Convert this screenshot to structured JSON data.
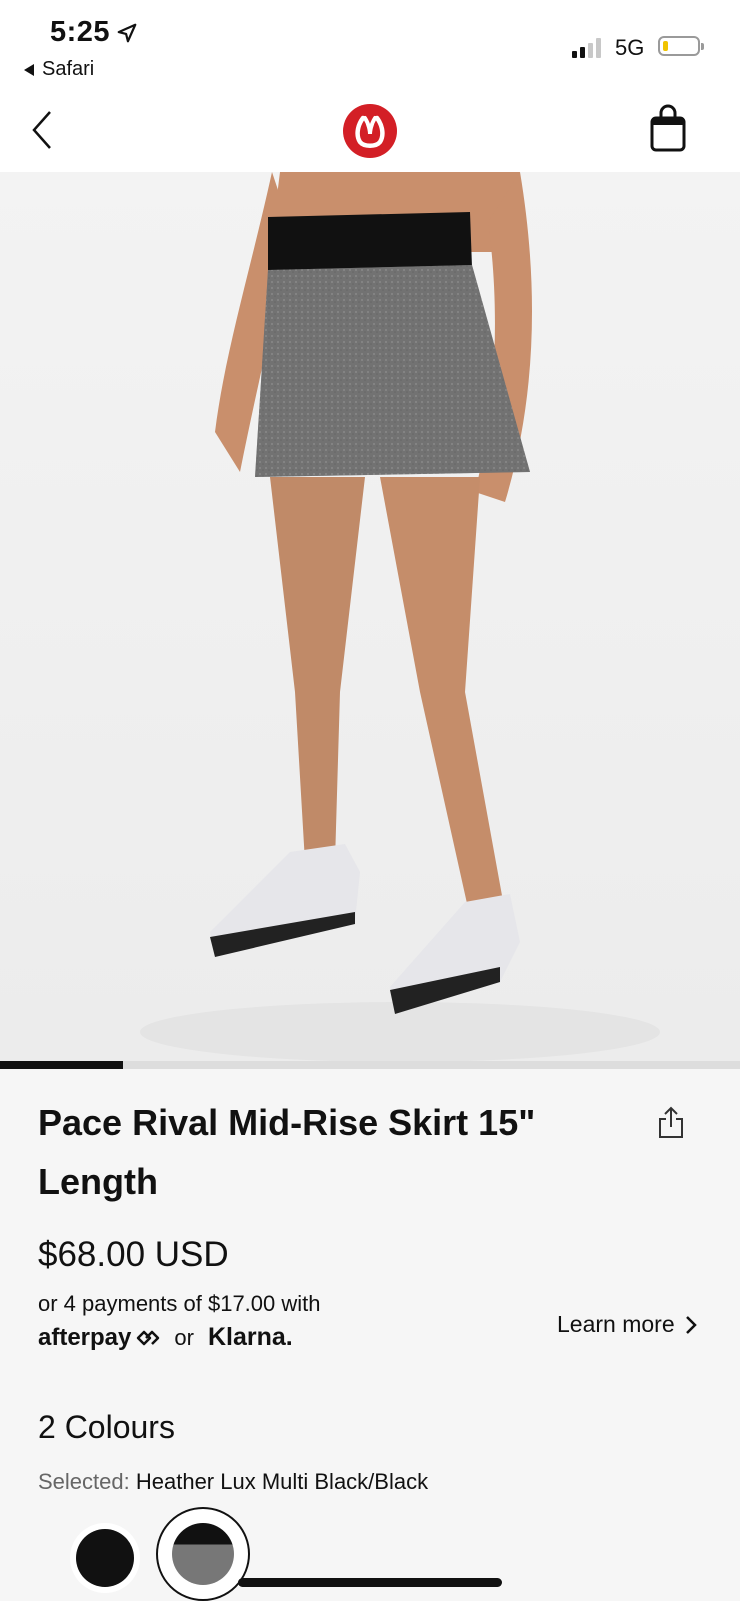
{
  "status_bar": {
    "time": "5:25",
    "back_app": "Safari",
    "network": "5G"
  },
  "nav": {
    "back_icon": "chevron-left-icon",
    "logo_icon": "lululemon-logo",
    "bag_icon": "shopping-bag-icon"
  },
  "gallery": {
    "progress": 0.166
  },
  "product": {
    "title": "Pace Rival Mid-Rise Skirt 15\" Length",
    "price": "$68.00 USD",
    "payments_text": "or 4 payments of $17.00 with",
    "afterpay_label": "afterpay",
    "or_label": "or",
    "klarna_label": "Klarna.",
    "learn_more": "Learn more",
    "colours_heading": "2 Colours",
    "selected_label": "Selected:",
    "selected_value": "Heather Lux Multi Black/Black"
  },
  "colors": {
    "brand_red": "#d31f26",
    "battery_yellow": "#f0c400"
  }
}
